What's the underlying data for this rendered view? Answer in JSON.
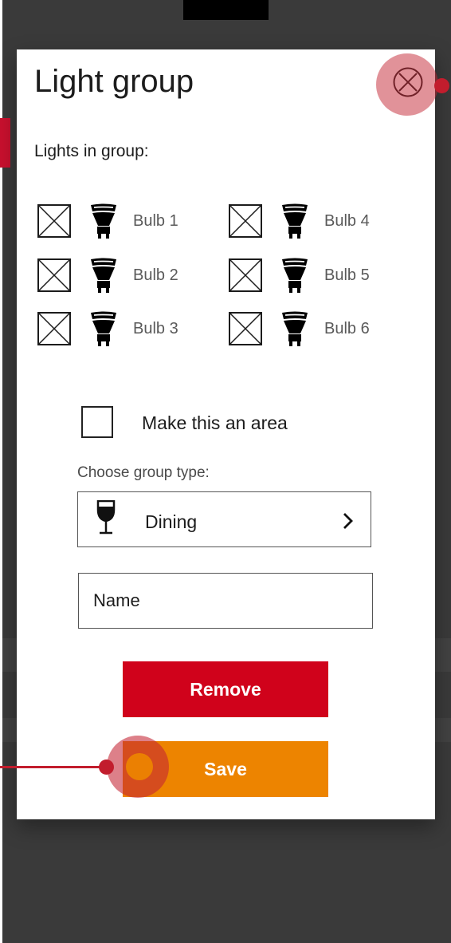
{
  "dialog": {
    "title": "Light group",
    "lights_label": "Lights in group:",
    "bulbs": [
      "Bulb 1",
      "Bulb 2",
      "Bulb 3",
      "Bulb 4",
      "Bulb 5",
      "Bulb 6"
    ],
    "area_label": "Make this an area",
    "area_checked": false,
    "group_type_label": "Choose group type:",
    "group_type_value": "Dining",
    "group_type_icon": "wine-glass-icon",
    "name_placeholder": "Name",
    "remove_label": "Remove",
    "save_label": "Save"
  },
  "colors": {
    "remove": "#d0021b",
    "save": "#ed8400",
    "annotation": "#c21d2d",
    "backdrop": "#3a3a3a"
  }
}
